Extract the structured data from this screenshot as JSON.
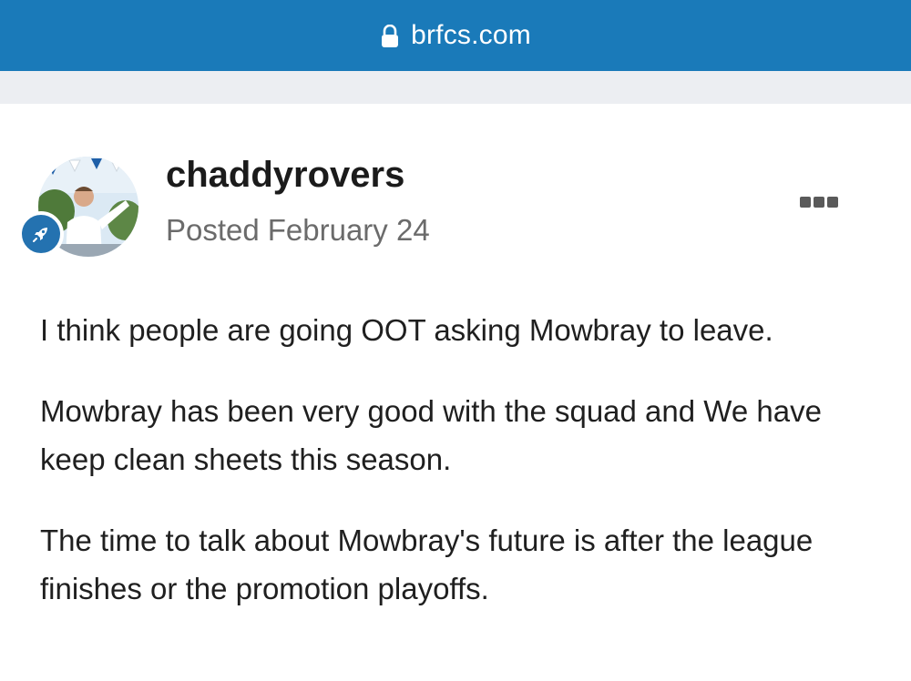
{
  "browser": {
    "url": "brfcs.com"
  },
  "post": {
    "username": "chaddyrovers",
    "posted_label": "Posted",
    "posted_date": "February 24",
    "avatar_icon": "user-avatar-photo",
    "badge_icon": "rocket-icon",
    "menu_icon": "more-options-icon",
    "paragraphs": [
      "I think people are going OOT asking Mowbray to leave.",
      "Mowbray has been very good with the squad and We have keep clean sheets this season.",
      "The time to talk about Mowbray's future is after the league finishes or the promotion playoffs."
    ]
  },
  "colors": {
    "url_bar": "#1a7ab9",
    "strip": "#eceef2",
    "badge": "#2472b0",
    "meta_text": "#6b6b6b"
  }
}
